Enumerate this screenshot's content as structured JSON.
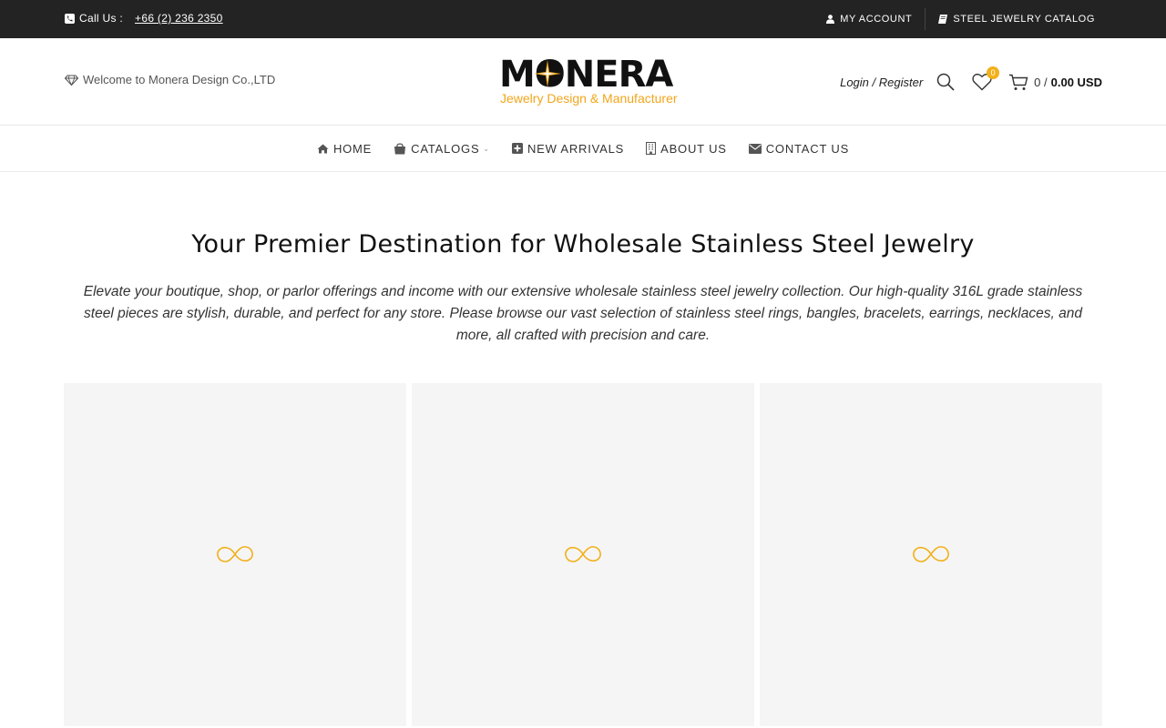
{
  "topbar": {
    "call_label": "Call Us :",
    "phone": "+66 (2) 236 2350",
    "links": [
      {
        "label": "MY ACCOUNT",
        "icon": "user-icon"
      },
      {
        "label": "STEEL JEWELRY CATALOG",
        "icon": "book-icon"
      }
    ]
  },
  "header": {
    "welcome": "Welcome to Monera Design Co.,LTD",
    "logo_brand": "MONERA",
    "logo_tagline": "Jewelry Design & Manufacturer",
    "login": "Login / Register",
    "wishlist_count": "0",
    "cart_count": "0 /",
    "cart_total": "0.00 USD"
  },
  "nav": [
    {
      "label": "HOME",
      "icon": "home-icon"
    },
    {
      "label": "CATALOGS",
      "icon": "shopping-bag-icon",
      "has_submenu": true
    },
    {
      "label": "NEW ARRIVALS",
      "icon": "plus-square-icon"
    },
    {
      "label": "ABOUT US",
      "icon": "building-icon"
    },
    {
      "label": "CONTACT US",
      "icon": "envelope-icon"
    }
  ],
  "main": {
    "title": "Your Premier Destination for Wholesale Stainless Steel Jewelry",
    "intro": "Elevate your boutique, shop, or parlor offerings and income with our extensive wholesale stainless steel jewelry collection. Our high-quality 316L grade stainless steel pieces are stylish, durable, and perfect for any store. Please browse our vast selection of stainless steel rings, bangles, bracelets, earrings, necklaces, and more, all crafted with precision and care."
  },
  "colors": {
    "topbar_bg": "#232323",
    "accent": "#f2b01a",
    "card_bg": "#f5f5f5"
  }
}
